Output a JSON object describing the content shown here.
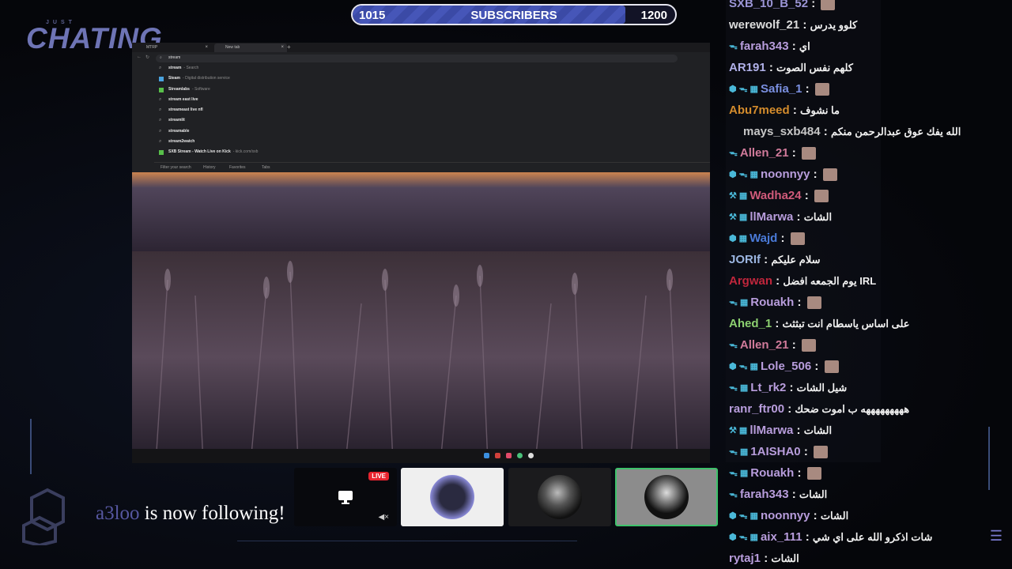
{
  "sub_goal": {
    "current": "1015",
    "label": "SUBSCRIBERS",
    "goal": "1200",
    "progress": 0.8459
  },
  "brand": {
    "small": "JUST",
    "title": "CHATING"
  },
  "browser": {
    "tab1": "MTRP",
    "tab2": "New tab",
    "new_tab": "+",
    "query": "stream",
    "suggestions": [
      {
        "icon": "search-icon",
        "title": "stream",
        "sub": "- Search"
      },
      {
        "icon": "app-icon",
        "title": "Steam",
        "sub": "- Digital distribution service"
      },
      {
        "icon": "app-icon",
        "title": "Streamlabs",
        "sub": "- Software"
      },
      {
        "icon": "search-icon",
        "title": "stream east live",
        "sub": ""
      },
      {
        "icon": "search-icon",
        "title": "streameast live nfl",
        "sub": ""
      },
      {
        "icon": "search-icon",
        "title": "streamlit",
        "sub": ""
      },
      {
        "icon": "search-icon",
        "title": "streamable",
        "sub": ""
      },
      {
        "icon": "search-icon",
        "title": "stream2watch",
        "sub": ""
      },
      {
        "icon": "kick-icon",
        "title": "SXB Stream - Watch Live on Kick",
        "sub": "- kick.com/sxb"
      }
    ],
    "footer": {
      "filter": "Filter your search",
      "history": "History",
      "favorites": "Favorites",
      "tabs": "Tabs"
    }
  },
  "cams": {
    "live_badge": "LIVE"
  },
  "follow_alert": {
    "name": "a3loo",
    "text": " is now following!"
  },
  "chat": [
    {
      "badges": "",
      "user": "SXB_10_B_52",
      "color": "#9b95d6",
      "text": "",
      "emote": true
    },
    {
      "badges": "",
      "user": "werewolf_21",
      "color": "#dcdcdc",
      "text": "كلوو يدرس",
      "emote": false
    },
    {
      "badges": "ᯓ",
      "user": "farah343",
      "color": "#b89ddc",
      "text": "اي",
      "emote": false
    },
    {
      "badges": "",
      "user": "AR191",
      "color": "#b0b0e8",
      "text": "كلهم نفس الصوت",
      "emote": false
    },
    {
      "badges": "⬢ ᯓ ▦",
      "user": "Safia_1",
      "color": "#7a8fe0",
      "text": "",
      "emote": true
    },
    {
      "badges": "",
      "user": "Abu7meed",
      "color": "#d48c2c",
      "text": "ما نشوف",
      "emote": false
    },
    {
      "badges": "",
      "user": "mays_sxb484",
      "color": "#c7c7c7",
      "text": "الله يفك عوق عبدالرحمن منكم",
      "emote": false,
      "indent": true
    },
    {
      "badges": "ᯓ",
      "user": "Allen_21",
      "color": "#d07a9a",
      "text": "",
      "emote": true
    },
    {
      "badges": "⬢ ᯓ ▦",
      "user": "noonnyy",
      "color": "#b89ddc",
      "text": "",
      "emote": true
    },
    {
      "badges": "⚒ ▦",
      "user": "Wadha24",
      "color": "#d05a7a",
      "text": "",
      "emote": true
    },
    {
      "badges": "⚒ ▦",
      "user": "llMarwa",
      "color": "#b89ddc",
      "text": "الشات",
      "emote": false
    },
    {
      "badges": "⬢ ▦",
      "user": "Wajd",
      "color": "#4a7ad8",
      "text": "",
      "emote": true
    },
    {
      "badges": "",
      "user": "JORIf",
      "color": "#9bb5e0",
      "text": "سلام عليكم",
      "emote": false
    },
    {
      "badges": "",
      "user": "Argwan",
      "color": "#c0263c",
      "text": "يوم الجمعه افضل IRL",
      "emote": false
    },
    {
      "badges": "ᯓ ▦",
      "user": "Rouakh",
      "color": "#b89ddc",
      "text": "",
      "emote": true
    },
    {
      "badges": "",
      "user": "Ahed_1",
      "color": "#8cd070",
      "text": "على اساس ياسطام انت تبثثث",
      "emote": false
    },
    {
      "badges": "ᯓ",
      "user": "Allen_21",
      "color": "#d07a9a",
      "text": "",
      "emote": true
    },
    {
      "badges": "⬢ ᯓ ▦",
      "user": "Lole_506",
      "color": "#b89ddc",
      "text": "",
      "emote": true
    },
    {
      "badges": "ᯓ ▦",
      "user": "Lt_rk2",
      "color": "#b89ddc",
      "text": "شيل الشات",
      "emote": false
    },
    {
      "badges": "",
      "user": "ranr_ftr00",
      "color": "#b89ddc",
      "text": "هههههههههه ب اموت ضحك",
      "emote": false
    },
    {
      "badges": "⚒ ▦",
      "user": "llMarwa",
      "color": "#b89ddc",
      "text": "الشات",
      "emote": false
    },
    {
      "badges": "ᯓ ▦",
      "user": "1AISHA0",
      "color": "#b89ddc",
      "text": "",
      "emote": true
    },
    {
      "badges": "ᯓ ▦",
      "user": "Rouakh",
      "color": "#b89ddc",
      "text": "",
      "emote": true
    },
    {
      "badges": "ᯓ",
      "user": "farah343",
      "color": "#b89ddc",
      "text": "الشات",
      "emote": false
    },
    {
      "badges": "⬢ ᯓ ▦",
      "user": "noonnyy",
      "color": "#b89ddc",
      "text": "الشات",
      "emote": false
    },
    {
      "badges": "⬢ ᯓ ▦",
      "user": "aix_111",
      "color": "#b89ddc",
      "text": "شات اذكرو الله على اي شي",
      "emote": false
    },
    {
      "badges": "",
      "user": "rytaj1",
      "color": "#b89ddc",
      "text": "الشات",
      "emote": false
    }
  ]
}
